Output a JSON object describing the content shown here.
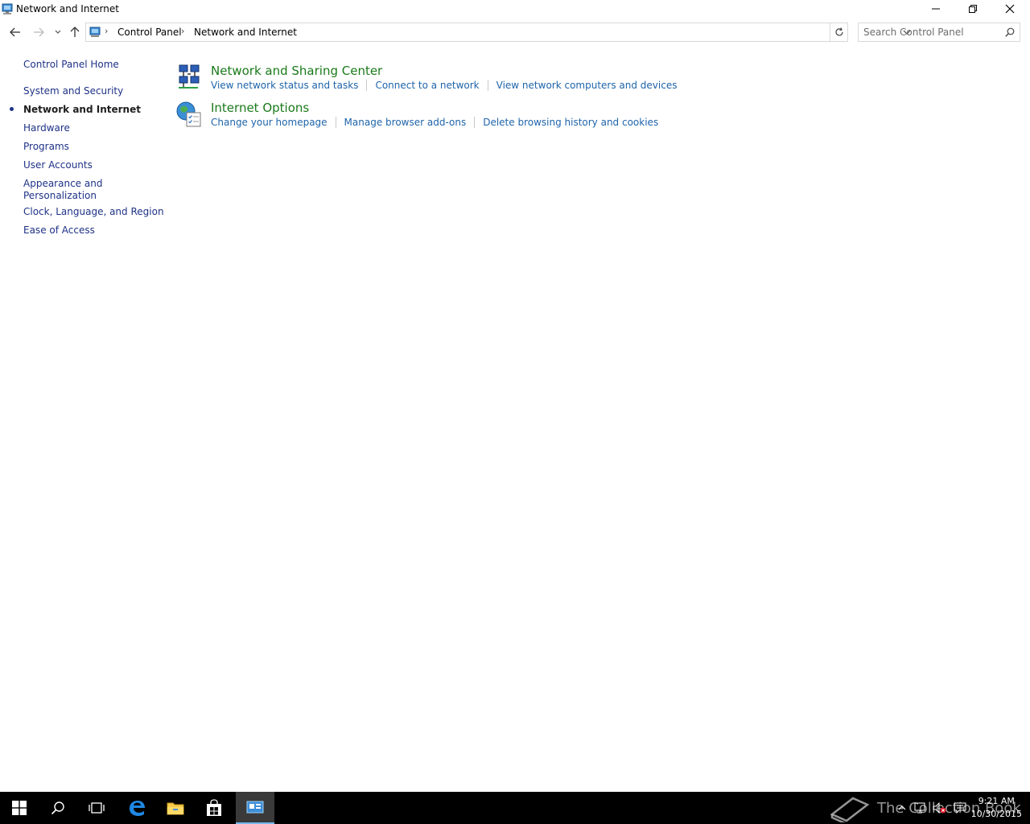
{
  "window": {
    "title": "Network and Internet"
  },
  "address_bar": {
    "breadcrumbs": [
      "Control Panel",
      "Network and Internet"
    ]
  },
  "search": {
    "placeholder": "Search Control Panel"
  },
  "sidebar": {
    "home": "Control Panel Home",
    "items": [
      {
        "label": "System and Security"
      },
      {
        "label": "Network and Internet",
        "current": true
      },
      {
        "label": "Hardware"
      },
      {
        "label": "Programs"
      },
      {
        "label": "User Accounts"
      },
      {
        "label": "Appearance and Personalization"
      },
      {
        "label": "Clock, Language, and Region"
      },
      {
        "label": "Ease of Access"
      }
    ]
  },
  "categories": [
    {
      "title": "Network and Sharing Center",
      "icon": "network-sharing-icon",
      "links": [
        "View network status and tasks",
        "Connect to a network",
        "View network computers and devices"
      ]
    },
    {
      "title": "Internet Options",
      "icon": "internet-options-icon",
      "links": [
        "Change your homepage",
        "Manage browser add-ons",
        "Delete browsing history and cookies"
      ]
    }
  ],
  "taskbar": {
    "clock_time": "9:21 AM",
    "clock_date": "10/30/2015",
    "watermark": "The Collection Book"
  },
  "colors": {
    "link": "#1e64aa",
    "category_title": "#1a7a1a",
    "left_link": "#1e3287",
    "taskbar": "#000000"
  }
}
